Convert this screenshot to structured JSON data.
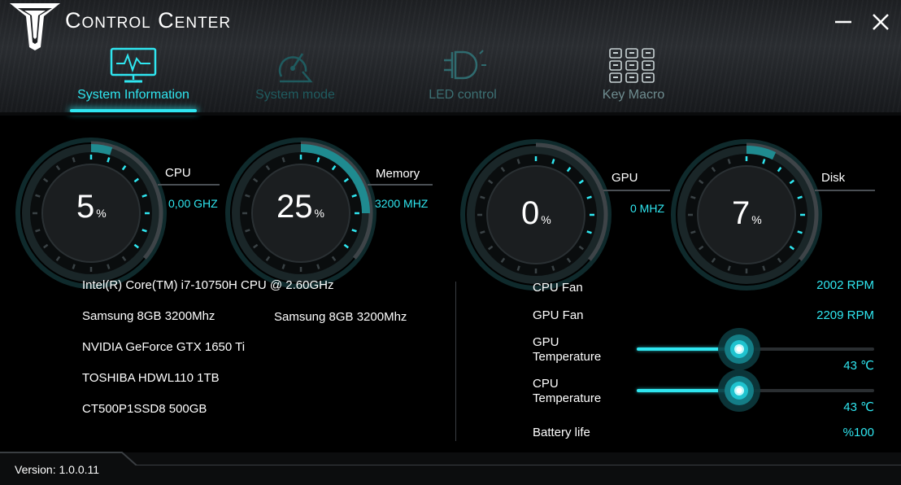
{
  "app": {
    "title": "Control Center"
  },
  "tabs": [
    {
      "label": "System Information",
      "icon": "monitor-pulse-icon"
    },
    {
      "label": "System mode",
      "icon": "gauge-icon"
    },
    {
      "label": "LED control",
      "icon": "light-bulb-icon"
    },
    {
      "label": "Key Macro",
      "icon": "keypad-icon"
    }
  ],
  "gauges": {
    "cpu": {
      "label": "CPU",
      "value": "5",
      "unit": "%",
      "sub": "0,00 GHZ",
      "fraction": 0.05
    },
    "memory": {
      "label": "Memory",
      "value": "25",
      "unit": "%",
      "sub": "3200 MHZ",
      "fraction": 0.25
    },
    "gpu": {
      "label": "GPU",
      "value": "0",
      "unit": "%",
      "sub": "0 MHZ",
      "fraction": 0.0
    },
    "disk": {
      "label": "Disk",
      "value": "7",
      "unit": "%",
      "fraction": 0.07
    }
  },
  "hardware": {
    "cpu": "Intel(R) Core(TM) i7-10750H CPU @ 2.60GHz",
    "ram_1": "Samsung 8GB 3200Mhz",
    "ram_2": "Samsung 8GB 3200Mhz",
    "gpu": "NVIDIA GeForce GTX 1650 Ti",
    "disk_1": "TOSHIBA HDWL110 1TB",
    "disk_2": "CT500P1SSD8 500GB"
  },
  "stats": {
    "cpu_fan": {
      "label": "CPU Fan",
      "value": "2002 RPM"
    },
    "gpu_fan": {
      "label": "GPU Fan",
      "value": "2209 RPM"
    },
    "gpu_temp": {
      "label": "GPU\nTemperature",
      "value": "43 ℃",
      "fraction": 0.43
    },
    "cpu_temp": {
      "label": "CPU\nTemperature",
      "value": "43 ℃",
      "fraction": 0.43
    },
    "battery": {
      "label": "Battery life",
      "value": "%100"
    }
  },
  "footer": {
    "version": "Version: 1.0.0.11"
  },
  "colors": {
    "accent": "#2fe6f0",
    "background": "#000000",
    "header": "#2a2d31"
  }
}
